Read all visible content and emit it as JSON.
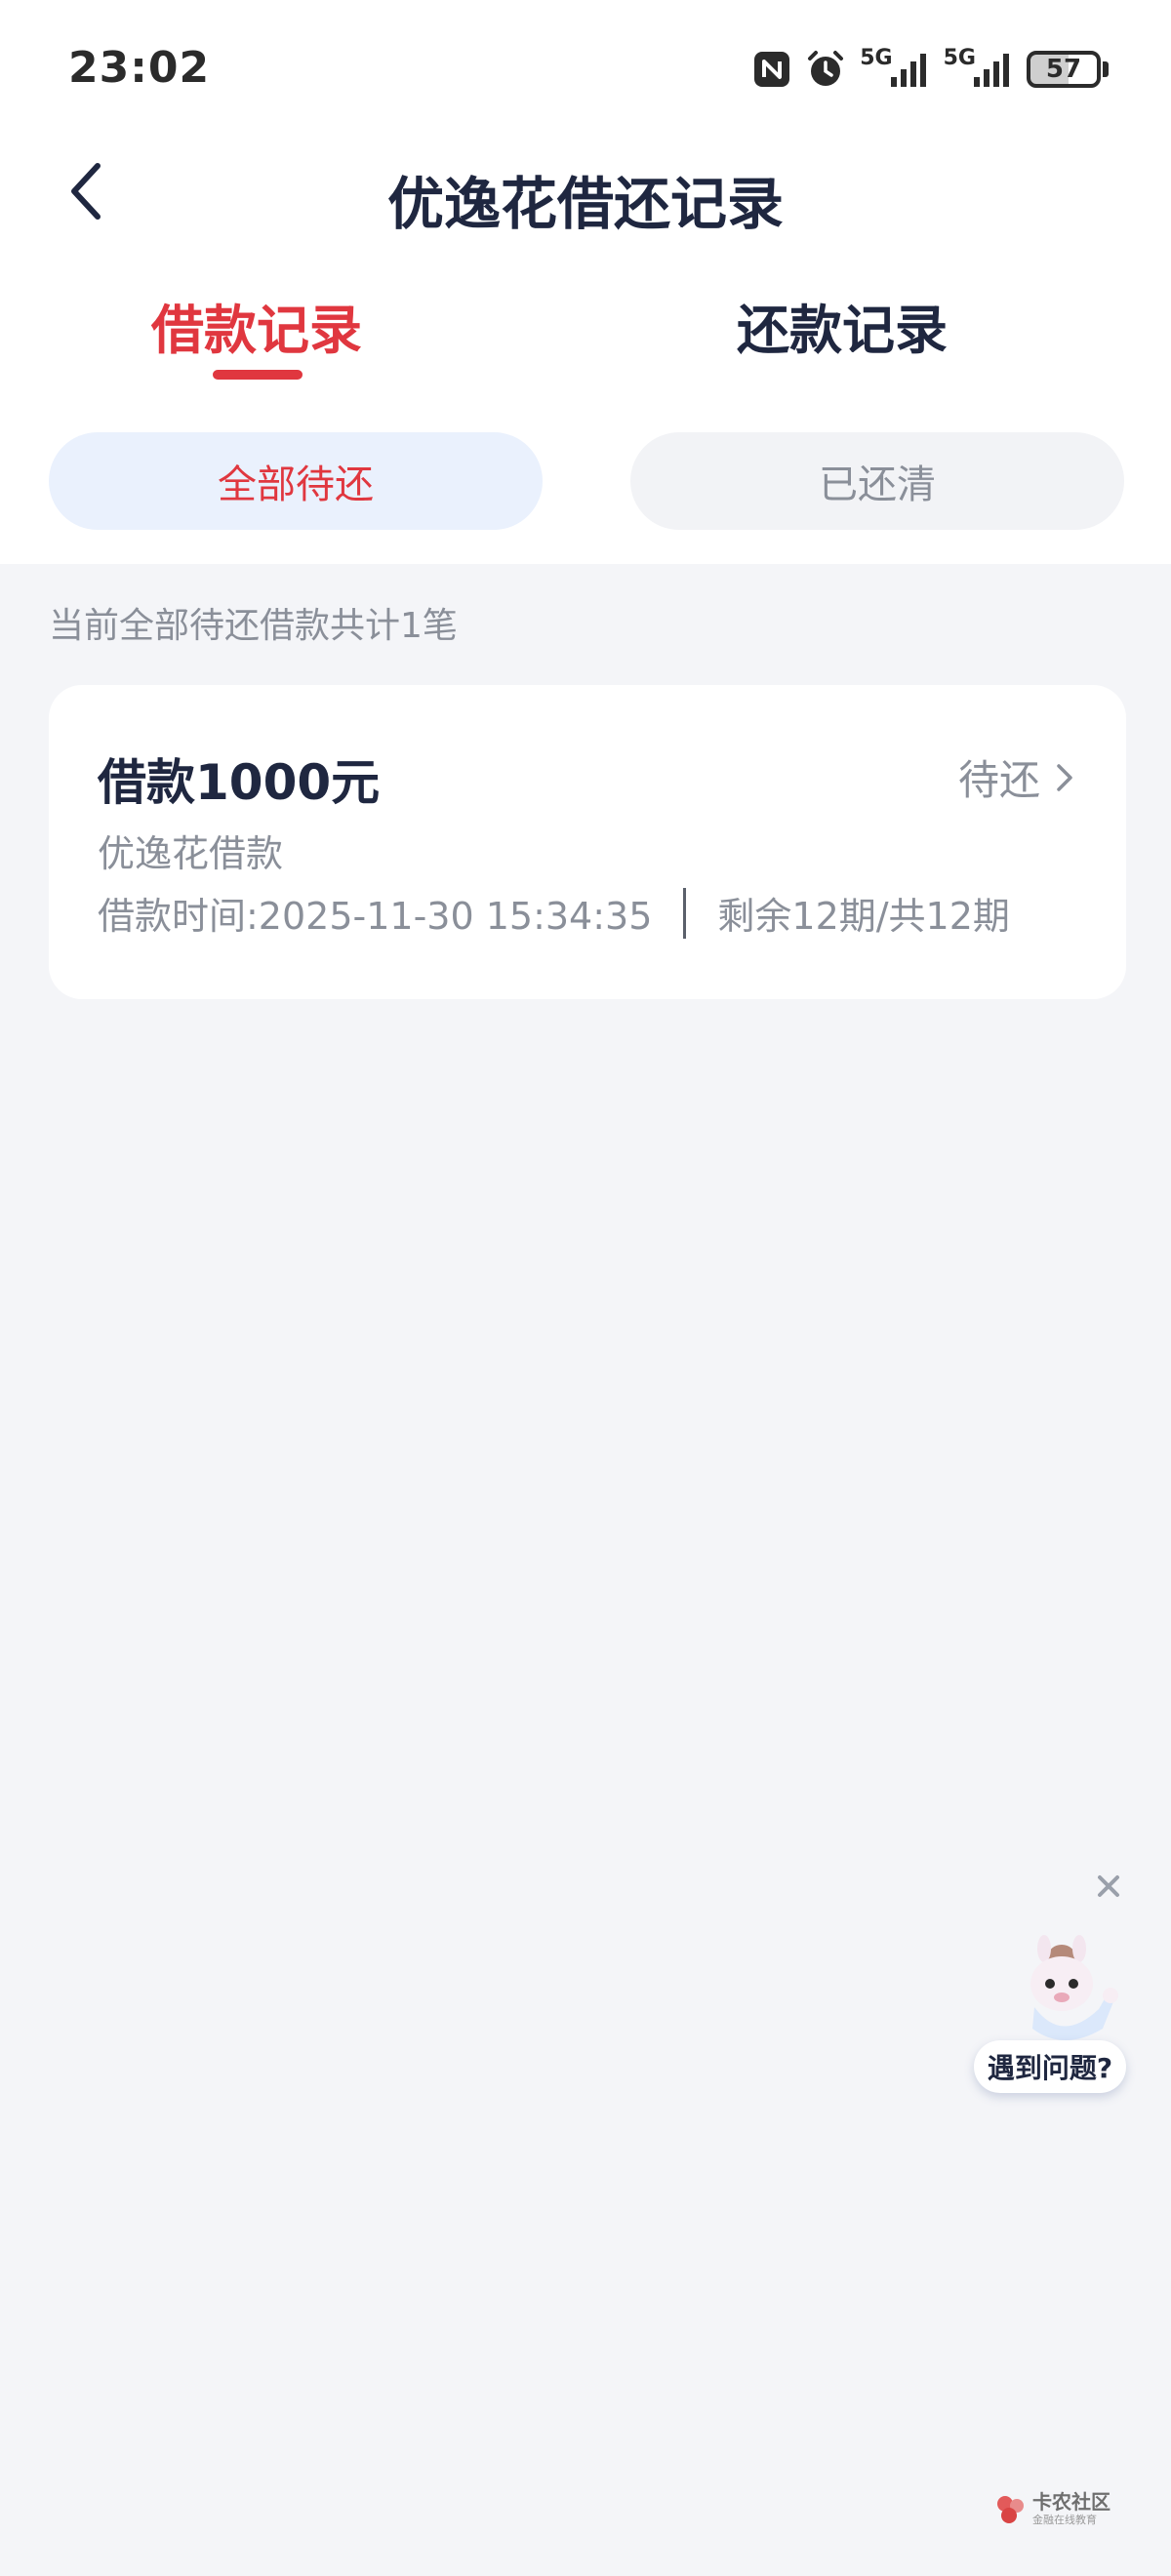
{
  "status_bar": {
    "time": "23:02",
    "signal_1_label": "5G",
    "signal_2_label": "5G",
    "battery": "57",
    "icons": [
      "nfc-icon",
      "alarm-icon",
      "signal-icon",
      "signal-icon",
      "battery-icon"
    ]
  },
  "nav": {
    "title": "优逸花借还记录",
    "back_icon": "chevron-left-icon"
  },
  "tabs": [
    {
      "label": "借款记录",
      "active": true
    },
    {
      "label": "还款记录",
      "active": false
    }
  ],
  "filters": [
    {
      "label": "全部待还",
      "active": true
    },
    {
      "label": "已还清",
      "active": false
    }
  ],
  "summary": "当前全部待还借款共计1笔",
  "loan": {
    "amount": "借款1000元",
    "status": "待还",
    "product": "优逸花借款",
    "time": "借款时间:2025-11-30 15:34:35",
    "periods": "剩余12期/共12期"
  },
  "help": {
    "label": "遇到问题?",
    "close_icon": "close-icon"
  },
  "watermark": {
    "name": "卡农社区",
    "sub": "金融在线教育"
  },
  "colors": {
    "accent": "#e0373f",
    "title": "#1f2740",
    "muted": "#8a8f99",
    "background": "#f4f5f8",
    "pill_active_bg": "#eaf1fd"
  }
}
